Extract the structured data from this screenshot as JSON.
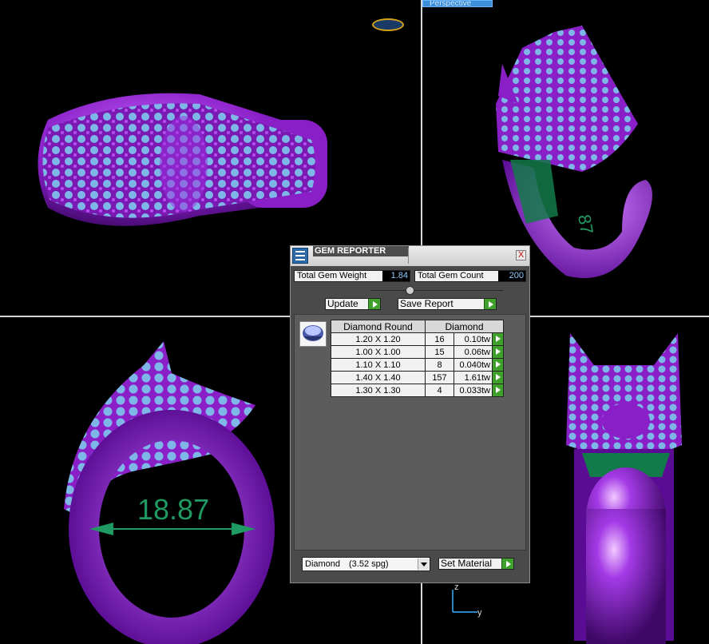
{
  "viewport": {
    "perspective_label": "Perspective",
    "measurement_value": "18.87",
    "axis_labels": {
      "z": "z",
      "y": "y"
    }
  },
  "gem_reporter": {
    "title": "GEM REPORTER",
    "close_label": "X",
    "total_gem_weight_label": "Total Gem Weight",
    "total_gem_weight_value": "1.84",
    "total_gem_count_label": "Total Gem Count",
    "total_gem_count_value": "200",
    "update_label": "Update",
    "save_report_label": "Save Report",
    "table": {
      "headers": [
        "Diamond Round",
        "Diamond"
      ],
      "rows": [
        {
          "size": "1.20 X 1.20",
          "count": "16",
          "weight": "0.10tw"
        },
        {
          "size": "1.00 X 1.00",
          "count": "15",
          "weight": "0.06tw"
        },
        {
          "size": "1.10 X 1.10",
          "count": "8",
          "weight": "0.040tw"
        },
        {
          "size": "1.40 X 1.40",
          "count": "157",
          "weight": "1.61tw"
        },
        {
          "size": "1.30 X 1.30",
          "count": "4",
          "weight": "0.033tw"
        }
      ]
    },
    "material_select": {
      "name": "Diamond",
      "spg": "(3.52 spg)"
    },
    "set_material_label": "Set Material"
  },
  "colors": {
    "metal": "#8a1fc8",
    "gems": "#7fb6e8",
    "measure": "#1e9a62",
    "play": "#3fa12c"
  }
}
